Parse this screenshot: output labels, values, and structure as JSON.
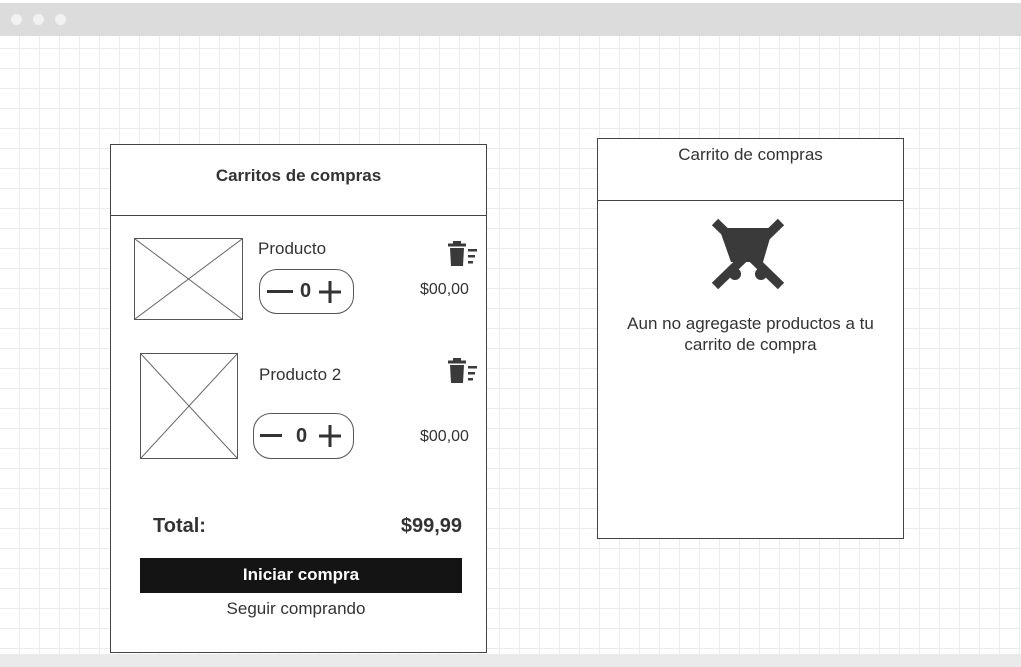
{
  "cart_panel": {
    "title": "Carritos de compras",
    "items": [
      {
        "name": "Producto",
        "quantity": "0",
        "price": "$00,00"
      },
      {
        "name": "Producto 2",
        "quantity": "0",
        "price": "$00,00"
      }
    ],
    "total_label": "Total:",
    "total_value": "$99,99",
    "checkout_label": "Iniciar compra",
    "continue_label": "Seguir comprando"
  },
  "empty_panel": {
    "title": "Carrito de compras",
    "message_line1": "Aun no agregaste productos a tu",
    "message_line2": "carrito de compra",
    "icon": "empty-cart-icon"
  },
  "icons": {
    "image_placeholder": "image-placeholder-icon",
    "remove": "trash-icon",
    "decrement": "minus-icon",
    "increment": "plus-icon"
  },
  "colors": {
    "button_bg": "#141414",
    "stroke": "#444444",
    "icon": "#3a3a3a"
  }
}
